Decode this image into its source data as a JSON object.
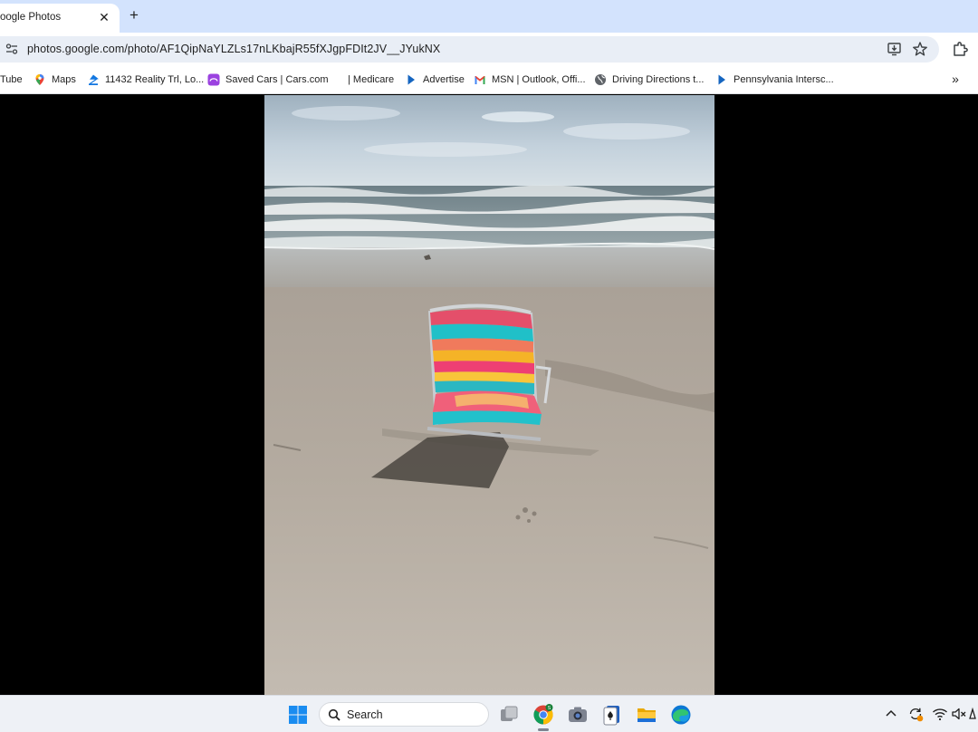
{
  "browser": {
    "tab": {
      "title": "oogle Photos",
      "close_glyph": "✕"
    },
    "new_tab_glyph": "+",
    "address_bar": {
      "url": "photos.google.com/photo/AF1QipNaYLZLs17nLKbajR55fXJgpFDIt2JV__JYukNX"
    },
    "bookmarks": [
      {
        "label": "Tube",
        "icon": "youtube-icon"
      },
      {
        "label": "Maps",
        "icon": "google-maps-icon"
      },
      {
        "label": "11432 Reality Trl, Lo...",
        "icon": "zillow-icon"
      },
      {
        "label": "Saved Cars | Cars.com",
        "icon": "cars-com-icon"
      },
      {
        "label": "| Medicare",
        "icon": "blank-icon"
      },
      {
        "label": "Advertise",
        "icon": "play-triangle-icon"
      },
      {
        "label": "MSN | Outlook, Offi...",
        "icon": "gmail-icon"
      },
      {
        "label": "Driving Directions t...",
        "icon": "globe-icon"
      },
      {
        "label": "Pennsylvania Intersc...",
        "icon": "play-triangle-icon"
      }
    ],
    "bookmarks_overflow_glyph": "»"
  },
  "viewer": {
    "photo_subject": "beach-chair-photo"
  },
  "taskbar": {
    "search_label": "Search",
    "pinned": [
      "windows-start-icon",
      "task-view-icon",
      "chrome-icon",
      "camera-icon",
      "solitaire-icon",
      "file-explorer-icon",
      "edge-icon"
    ]
  },
  "colors": {
    "tabstrip": "#d3e3fd",
    "omnibox": "#e9eef6",
    "taskbar": "#eef1f6",
    "viewer_bg": "#000000"
  }
}
